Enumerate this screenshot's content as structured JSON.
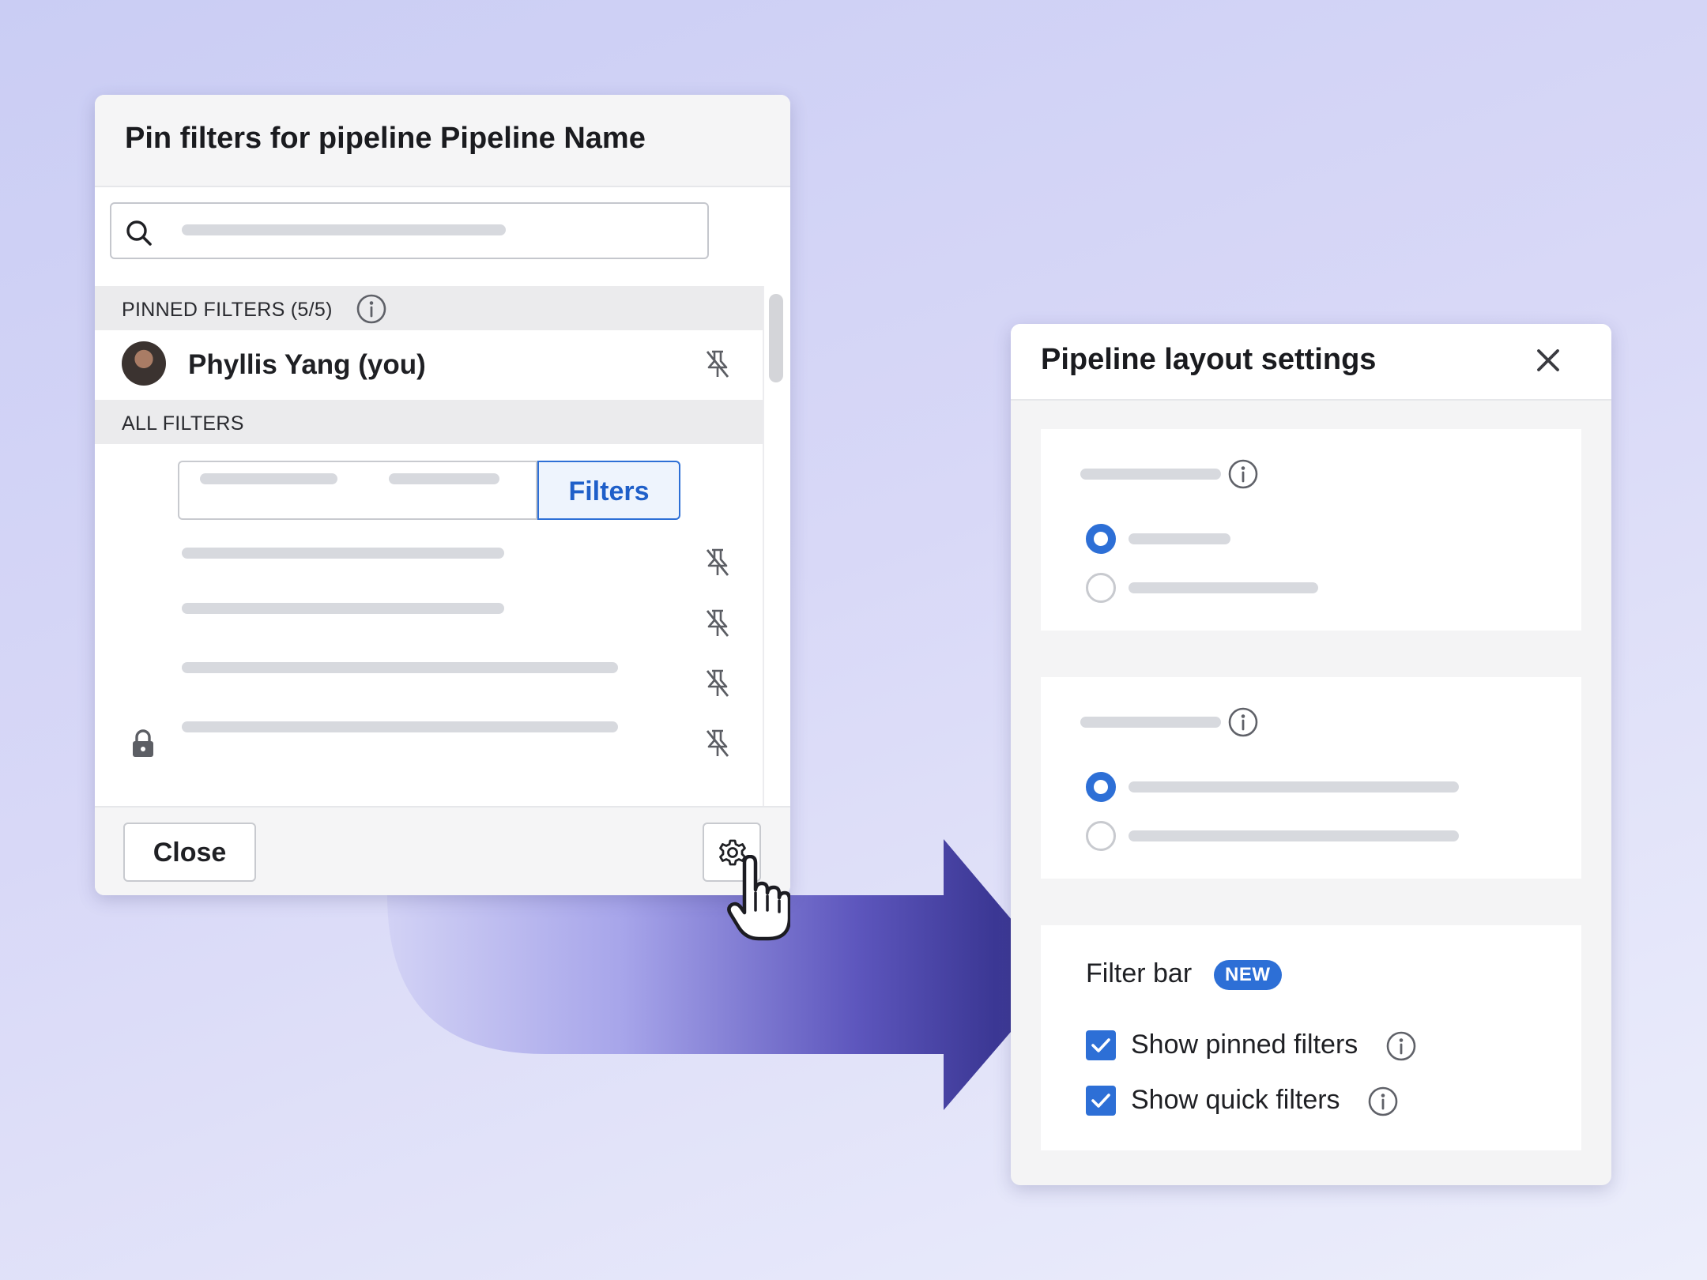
{
  "pin_panel": {
    "title": "Pin filters for pipeline Pipeline Name",
    "pinned_section_label": "PINNED FILTERS (5/5)",
    "pinned_user": "Phyllis Yang (you)",
    "all_section_label": "ALL FILTERS",
    "segments": [
      "",
      "",
      "Filters"
    ],
    "close_label": "Close"
  },
  "settings_panel": {
    "title": "Pipeline layout settings",
    "filter_bar_label": "Filter bar",
    "new_badge": "NEW",
    "options": [
      {
        "label": "Show pinned filters",
        "checked": true
      },
      {
        "label": "Show quick filters",
        "checked": true
      }
    ]
  },
  "icons": [
    "search-icon",
    "info-icon",
    "unpin-icon",
    "lock-icon",
    "gear-icon",
    "close-icon",
    "checkmark-icon",
    "hand-cursor-icon"
  ],
  "colors": {
    "accent": "#2d6fd6",
    "arrow_dark": "#3b3794",
    "arrow_light": "#c9c9f2",
    "background": "#d4d5f6"
  }
}
